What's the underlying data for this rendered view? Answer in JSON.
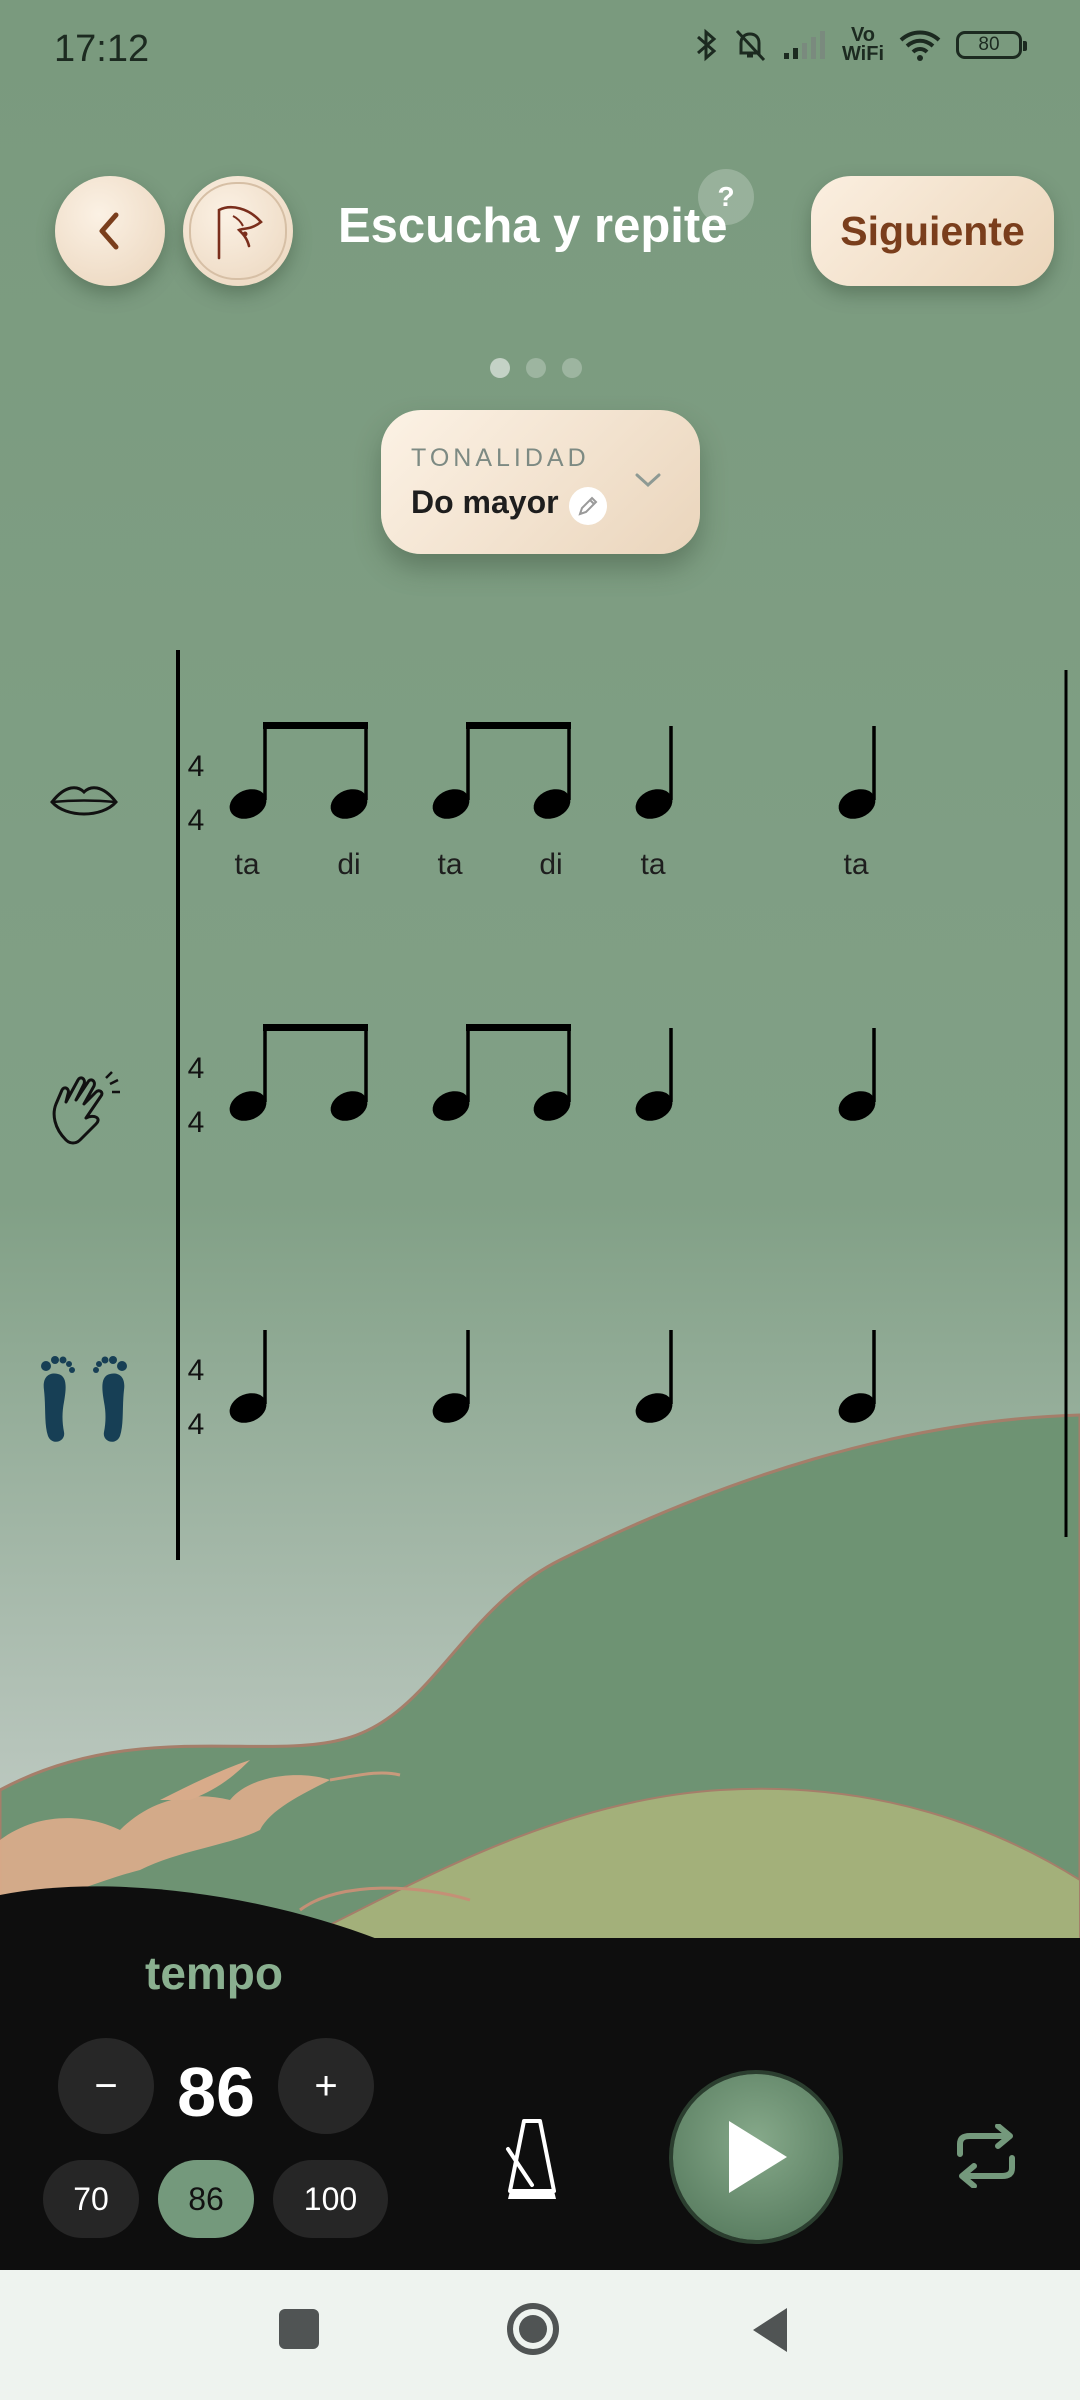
{
  "status_bar": {
    "time": "17:12",
    "network": "Vo\nWiFi",
    "battery": "80"
  },
  "header": {
    "title": "Escucha y repite",
    "help": "?",
    "next_label": "Siguiente"
  },
  "pager": {
    "total": 3,
    "current": 1
  },
  "key_selector": {
    "label": "TONALIDAD",
    "value": "Do mayor"
  },
  "score": {
    "time_signature": [
      "4",
      "4"
    ],
    "rows": [
      {
        "icon": "lips-icon",
        "rhythm": [
          "eighth-pair",
          "eighth-pair",
          "quarter",
          "quarter"
        ],
        "syllables": [
          "ta",
          "di",
          "ta",
          "di",
          "ta",
          "ta"
        ]
      },
      {
        "icon": "clapping-hands-icon",
        "rhythm": [
          "eighth-pair",
          "eighth-pair",
          "quarter",
          "quarter"
        ]
      },
      {
        "icon": "footprints-icon",
        "rhythm": [
          "quarter",
          "quarter",
          "quarter",
          "quarter"
        ]
      }
    ]
  },
  "tempo": {
    "label": "tempo",
    "value": "86",
    "minus": "−",
    "plus": "+",
    "presets": [
      "70",
      "86",
      "100"
    ],
    "selected_preset": "86"
  },
  "colors": {
    "sky": "#7a9a7e",
    "hill_green": "#6e9373",
    "hill_olive": "#a3b07a",
    "accent_brown": "#7a3e1c",
    "panel": "#0e0e0e",
    "play_green": "#6b8f72"
  },
  "icons": [
    "back-chevron-icon",
    "logo-icon",
    "edit-pencil-icon",
    "chevron-down-icon",
    "metronome-icon",
    "play-icon",
    "repeat-icon"
  ]
}
